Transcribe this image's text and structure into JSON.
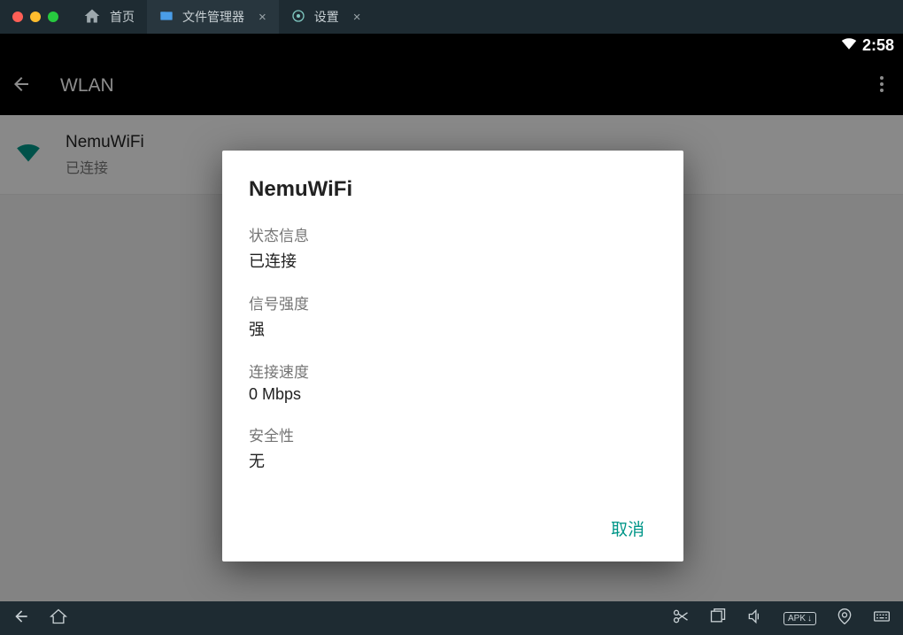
{
  "emu": {
    "home_label": "首页",
    "tab_files": "文件管理器",
    "tab_settings": "设置"
  },
  "status": {
    "time": "2:58"
  },
  "appbar": {
    "title": "WLAN"
  },
  "wlan_item": {
    "name": "NemuWiFi",
    "status": "已连接"
  },
  "dialog": {
    "title": "NemuWiFi",
    "fields": {
      "status_label": "状态信息",
      "status_value": "已连接",
      "signal_label": "信号强度",
      "signal_value": "强",
      "speed_label": "连接速度",
      "speed_value": "0 Mbps",
      "security_label": "安全性",
      "security_value": "无"
    },
    "cancel": "取消"
  },
  "bottombar": {
    "apk_label": "APK"
  }
}
